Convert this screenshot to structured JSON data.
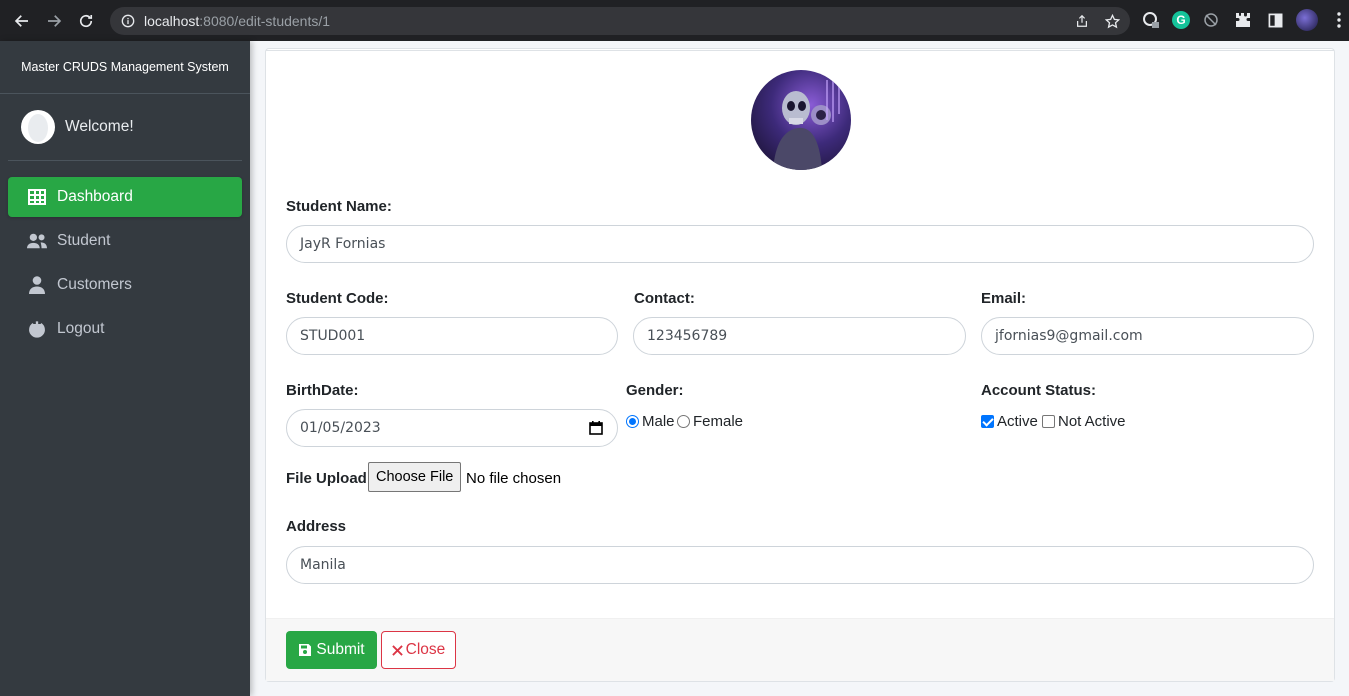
{
  "browser": {
    "url_host": "localhost",
    "url_rest": ":8080/edit-students/1"
  },
  "sidebar": {
    "brand": "Master CRUDS Management System",
    "welcome": "Welcome!",
    "items": [
      {
        "label": "Dashboard",
        "icon": "table-grid-icon",
        "active": true
      },
      {
        "label": "Student",
        "icon": "users-icon",
        "active": false
      },
      {
        "label": "Customers",
        "icon": "user-icon",
        "active": false
      },
      {
        "label": "Logout",
        "icon": "power-icon",
        "active": false
      }
    ]
  },
  "form": {
    "student_name_label": "Student Name:",
    "student_name_value": "JayR Fornias",
    "student_code_label": "Student Code:",
    "student_code_value": "STUD001",
    "contact_label": "Contact:",
    "contact_value": "123456789",
    "email_label": "Email:",
    "email_value": "jfornias9@gmail.com",
    "birthdate_label": "BirthDate:",
    "birthdate_value": "01/05/2023",
    "gender_label": "Gender:",
    "gender_options": [
      "Male",
      "Female"
    ],
    "gender_selected": "Male",
    "account_status_label": "Account Status:",
    "status_options": [
      "Active",
      "Not Active"
    ],
    "status_checked": [
      "Active"
    ],
    "file_upload_label": "File Upload",
    "file_button": "Choose File",
    "file_status": "No file chosen",
    "address_label": "Address",
    "address_value": "Manila"
  },
  "footer": {
    "submit_label": "Submit",
    "close_label": "Close"
  },
  "colors": {
    "sidebar_bg": "#343a40",
    "active_green": "#28a745",
    "close_red": "#dc3545"
  }
}
